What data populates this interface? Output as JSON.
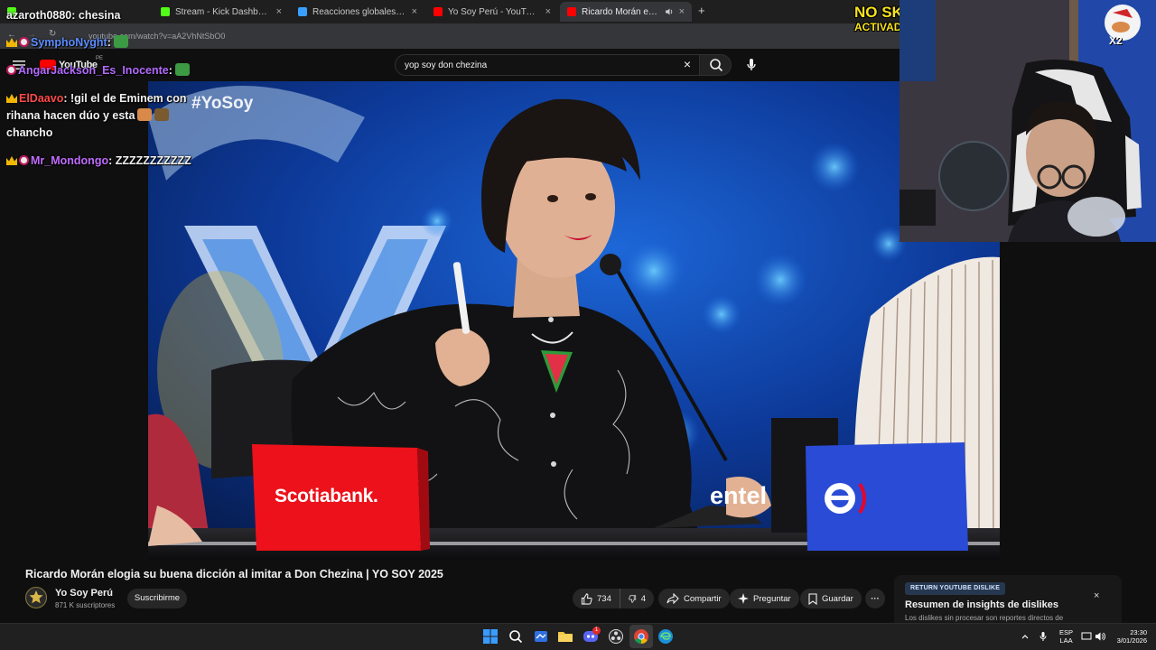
{
  "browser": {
    "tabs": [
      {
        "label": "Stream - Kick Dashboard",
        "close": "×"
      },
      {
        "label": "Reacciones globales: condenan",
        "close": "×"
      },
      {
        "label": "Yo Soy Perú - YouTube",
        "close": "×"
      },
      {
        "label": "Ricardo Morán elogia su bu",
        "close": "×"
      }
    ],
    "new_tab": "+",
    "address": "youtube.com/watch?v=aA2VhNtSbO0"
  },
  "youtube": {
    "logo": "YouTube",
    "region": "PE",
    "search_value": "yop soy don chezina",
    "search_clear": "×"
  },
  "chat": {
    "messages": [
      {
        "user": "azaroth0880",
        "text": "chesina"
      },
      {
        "user": "SymphoNyght",
        "text": ""
      },
      {
        "user": "AngarJackson_Es_Inocente",
        "text": ""
      },
      {
        "user": "ElDaavo",
        "text": "!gil el de Eminem con rihana hacen dúo y esta",
        "text2": "chancho"
      },
      {
        "user": "Mr_Mondongo",
        "text": "ZZZZZZZZZZZ"
      }
    ],
    "colors": {
      "symphonyght": "#5b8cff",
      "angar": "#b36bff",
      "eldaavo": "#ff4a4a",
      "mondongo": "#c06bff"
    }
  },
  "video": {
    "watermark": "#YoSoy",
    "sponsor_left": "Scotiabank.",
    "sponsor_right": "entel",
    "sponsor_right_mark": "e"
  },
  "overlay": {
    "line1": "NO SKIP NO BAN",
    "line2": "ACTIVADO !!",
    "line1_color": "#f7e21c",
    "line2_color": "#f7e21c"
  },
  "webcam": {
    "sticker_text": "X2"
  },
  "video_info": {
    "title": "Ricardo Morán elogia su buena dicción al imitar a Don Chezina | YO SOY 2025",
    "channel": "Yo Soy Perú",
    "subscribers": "871 K suscriptores",
    "subscribe": "Suscribirme",
    "likes": "734",
    "dislikes": "4",
    "share": "Compartir",
    "ask": "Preguntar",
    "save": "Guardar",
    "more": "···"
  },
  "dislike_panel": {
    "tag": "RETURN YOUTUBE DISLIKE",
    "title": "Resumen de insights de dislikes",
    "desc": "Los dislikes sin procesar son reportes directos de",
    "close": "×"
  },
  "taskbar": {
    "lang_top": "ESP",
    "lang_bottom": "LAA",
    "time": "23:30",
    "date": "3/01/2026",
    "chat_notification": "1"
  }
}
